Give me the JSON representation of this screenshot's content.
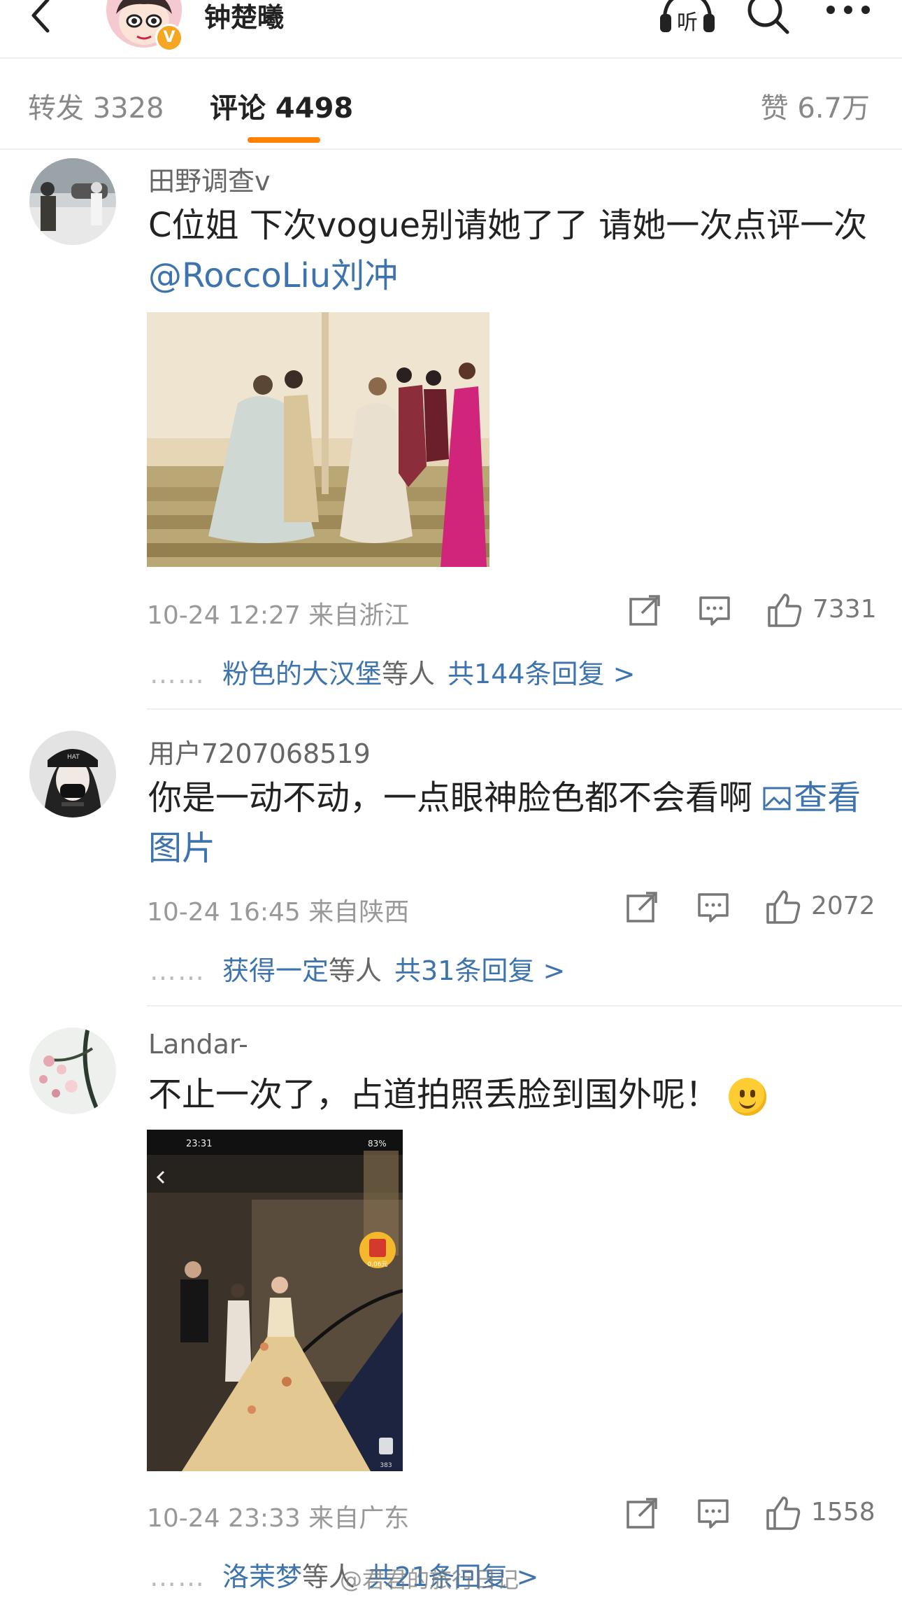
{
  "header": {
    "title": "钟楚曦",
    "verified_badge": "V",
    "listen_label": "听",
    "icons": [
      "back-arrow-icon",
      "headphones-icon",
      "search-icon",
      "more-dots-icon"
    ]
  },
  "tabs": {
    "repost": "转发 3328",
    "comments": "评论 4498",
    "likes": "赞 6.7万",
    "active": "comments",
    "accent_color": "#ff8200"
  },
  "comments": [
    {
      "user": "田野调查v",
      "text": "C位姐 下次vogue别请她了了 请她一次点评一次 ",
      "mention": "@RoccoLiu刘冲",
      "has_image": true,
      "meta": "10-24 12:27 来自浙江",
      "likes": "7331",
      "reply_names": "粉色的大汉堡",
      "reply_mid": "等人",
      "reply_total": "共144条回复 >"
    },
    {
      "user": "用户7207068519",
      "text": "你是一动不动，一点眼神脸色都不会看啊 ",
      "view_image_link": "查看图片",
      "meta": "10-24 16:45 来自陕西",
      "likes": "2072",
      "reply_names": "获得一定",
      "reply_mid": "等人",
      "reply_total": "共31条回复 >"
    },
    {
      "user": "Landar-",
      "text": "不止一次了，占道拍照丢脸到国外呢！",
      "emoji": "smile-emoji",
      "has_image": true,
      "screenshot": {
        "time": "23:31",
        "battery": "83%",
        "redpacket": "0.06元",
        "like_count": "383"
      },
      "meta": "10-24 23:33 来自广东",
      "likes": "1558",
      "reply_names": "洛茉梦",
      "reply_mid": "等人",
      "reply_total": "共21条回复 >"
    }
  ],
  "reply_dots": "……",
  "watermark": "@君君的旅行日记",
  "colors": {
    "link": "#3e74ad",
    "meta": "#999999",
    "badge": "#f5a623"
  }
}
